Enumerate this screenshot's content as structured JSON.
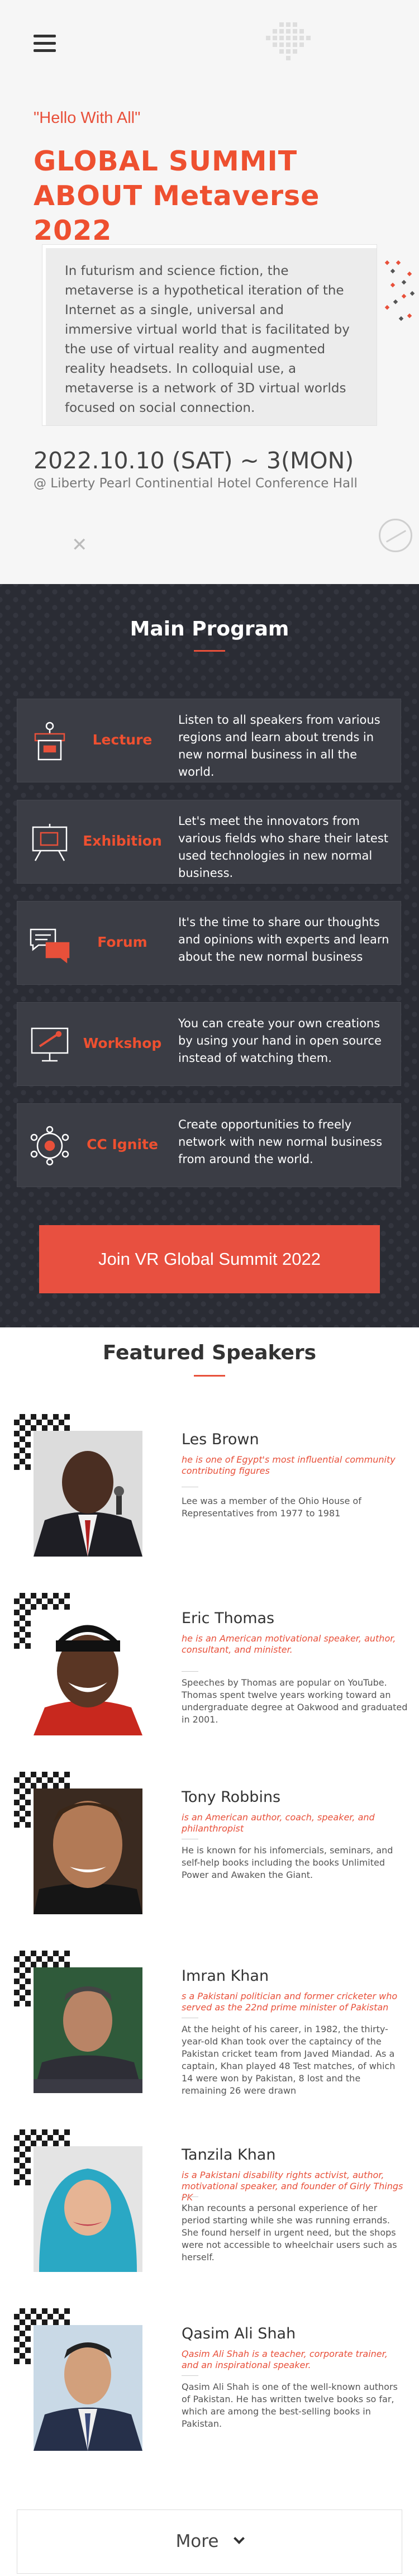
{
  "hero": {
    "greeting": "\"Hello With All\"",
    "title": "GLOBAL SUMMIT ABOUT Metaverse 2022",
    "intro": "In futurism and science fiction, the metaverse is a hypothetical iteration of the Internet as a single, universal and immersive virtual world that is facilitated by the use of virtual reality and augmented reality headsets. In colloquial use, a metaverse is a network of 3D virtual worlds focused on social connection.",
    "date": "2022.10.10 (SAT) ~ 3(MON)",
    "venue": "@ Liberty Pearl Continential Hotel Conference Hall"
  },
  "program": {
    "heading": "Main Program",
    "items": [
      {
        "label": "Lecture",
        "icon": "lectern-icon",
        "desc": "Listen to all speakers from various regions and learn about trends in new normal business in all the world."
      },
      {
        "label": "Exhibition",
        "icon": "easel-icon",
        "desc": "Let's meet the innovators from various fields who share their latest used technologies in new normal business."
      },
      {
        "label": "Forum",
        "icon": "chat-bubbles-icon",
        "desc": "It's the time to share our thoughts and opinions with experts and learn about the new normal business"
      },
      {
        "label": "Workshop",
        "icon": "whiteboard-icon",
        "desc": "You can create your own creations by using your hand in open source instead of watching them."
      },
      {
        "label": "CC Ignite",
        "icon": "network-icon",
        "desc": "Create opportunities to freely network with new normal business from around the world."
      }
    ],
    "join_label": "Join VR Global Summit 2022"
  },
  "speakers": {
    "heading": "Featured Speakers",
    "items": [
      {
        "name": "Les Brown",
        "role": "he is one of Egypt's most influential community contributing figures",
        "bio": "Lee was a member of the Ohio House of Representatives from 1977 to 1981"
      },
      {
        "name": "Eric Thomas",
        "role": "he is an American motivational speaker, author, consultant, and minister.",
        "bio": "Speeches by Thomas are popular on YouTube. Thomas spent twelve years working toward an undergraduate degree at Oakwood and graduated in 2001."
      },
      {
        "name": "Tony Robbins",
        "role": "is an American author, coach, speaker, and philanthropist",
        "bio": "He is known for his infomercials, seminars, and self-help books including the books Unlimited Power and Awaken the Giant."
      },
      {
        "name": "Imran Khan",
        "role": "s a Pakistani politician and former cricketer who served as the 22nd prime minister of Pakistan",
        "bio": "At the height of his career, in 1982, the thirty-year-old Khan took over the captaincy of the Pakistan cricket team from Javed Miandad. As a captain, Khan played 48 Test matches, of which 14 were won by Pakistan, 8 lost and the remaining 26 were drawn"
      },
      {
        "name": "Tanzila Khan",
        "role": "is a Pakistani disability rights activist, author, motivational speaker, and founder of Girly Things PK",
        "bio": "Khan recounts a personal experience of her period starting while she was running errands. She found herself in urgent need, but the shops were not accessible to wheelchair users such as herself."
      },
      {
        "name": "Qasim Ali Shah",
        "role": "Qasim Ali Shah is a teacher, corporate trainer, and an inspirational speaker.",
        "bio": "Qasim Ali Shah is one of the well-known authors of Pakistan. He has written twelve books so far, which are among the best-selling books in Pakistan."
      }
    ],
    "more_label": "More"
  },
  "colors": {
    "accent": "#e8503a",
    "dark_bg": "#2a2c34",
    "card_bg": "#3b3d45"
  }
}
